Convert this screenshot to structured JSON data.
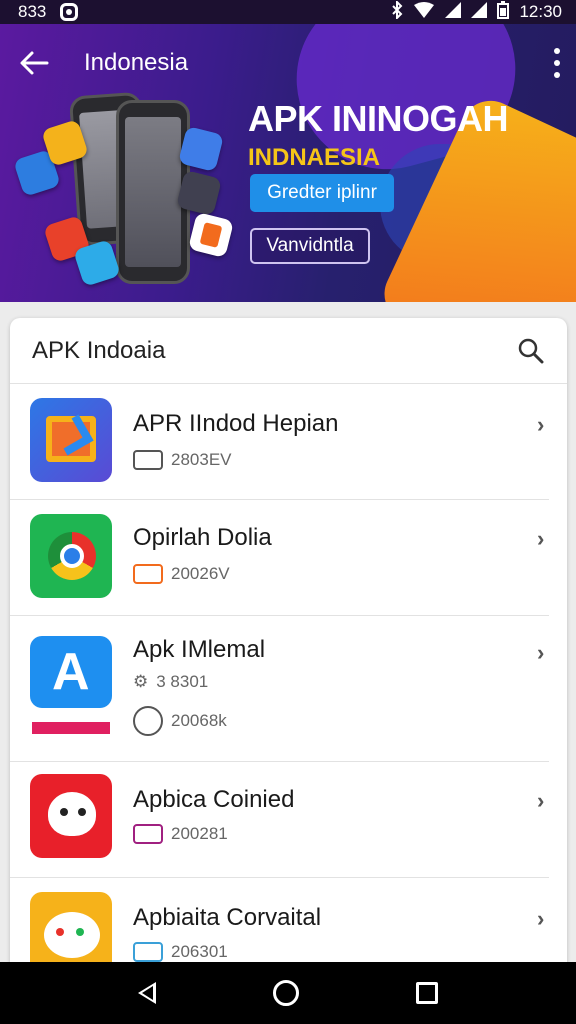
{
  "status_bar": {
    "time_left": "833",
    "time_right": "12:30",
    "icons": [
      "bluetooth-icon",
      "wifi-icon",
      "signal-icon",
      "signal-icon",
      "battery-icon"
    ]
  },
  "header": {
    "title": "Indonesia",
    "back_icon": "arrow-left-icon",
    "more_icon": "more-vertical-icon"
  },
  "banner": {
    "title": "APK ININOGAH",
    "subtitle": "INDNAESIA",
    "primary_button": "Gredter iplinr",
    "secondary_button": "Vanvidntla",
    "colors": {
      "bg_start": "#5b1aa0",
      "bg_end": "#241b5e",
      "accent_yellow": "#f5c518",
      "accent_orange": "#f26b1d",
      "button_blue": "#1f8fe8"
    }
  },
  "list_card": {
    "title": "APK Indoaia",
    "search_icon": "search-icon",
    "apps": [
      {
        "name": "APR IIndod Hepian",
        "meta": [
          "2803EV"
        ],
        "icon": "app-icon-blue-frame",
        "color": "#3a5fd8"
      },
      {
        "name": "Opirlah Dolia",
        "meta": [
          "20026V"
        ],
        "icon": "app-icon-chrome",
        "color": "#1fb552"
      },
      {
        "name": "Apk IMlemal",
        "meta": [
          "3 8301",
          "20068k"
        ],
        "icon": "app-icon-appstore",
        "color": "#1e8ff0"
      },
      {
        "name": "Apbica Coinied",
        "meta": [
          "200281"
        ],
        "icon": "app-icon-red-face",
        "color": "#e8202a"
      },
      {
        "name": "Apbiaita Corvaital",
        "meta": [
          "206301"
        ],
        "icon": "app-icon-yellow-cat",
        "color": "#f6b21a"
      }
    ]
  },
  "nav_bar": {
    "icons": [
      "nav-back-icon",
      "nav-home-icon",
      "nav-recents-icon"
    ]
  }
}
